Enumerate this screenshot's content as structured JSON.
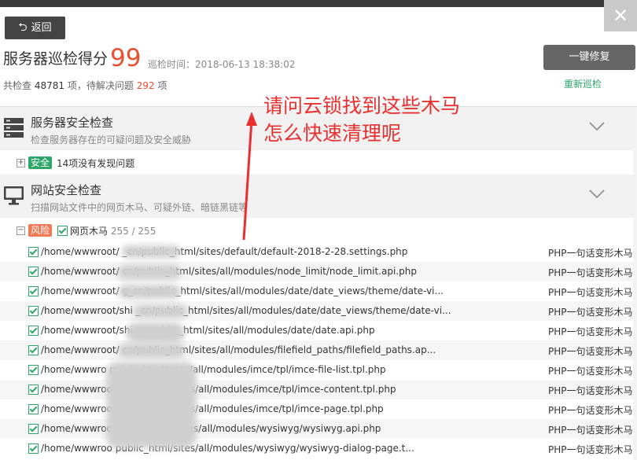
{
  "window": {
    "close_label": "✕"
  },
  "header": {
    "back_label": "返回",
    "score_title": "服务器巡检得分",
    "score": "99",
    "inspect_time": "巡检时间：2018-06-13 18:38:02",
    "summary_prefix": "共检查",
    "checked_count": "48781",
    "summary_mid": "项，待解决问题",
    "issue_count": "292",
    "summary_suffix": "项",
    "fix_button": "一键修复",
    "rescan_link": "重新巡检"
  },
  "annotation": {
    "line1": "请问云锁找到这些木马",
    "line2": "怎么快速清理呢"
  },
  "sections": [
    {
      "title": "服务器安全检查",
      "desc": "检查服务器存在的可疑问题及安全威胁",
      "sub": {
        "expander": "+",
        "tag": "安全",
        "label": "14项没有发现问题"
      }
    },
    {
      "title": "网站安全检查",
      "desc": "扫描网站文件中的网页木马、可疑外链、暗链黑链等",
      "sub": {
        "expander": "−",
        "tag": "风险",
        "label": "网页木马",
        "count": "255 / 255"
      }
    }
  ],
  "files": [
    {
      "path": "/home/wwwroot/                    _cn/public_html/sites/default/default-2018-2-28.settings.php",
      "type": "PHP一句话变形木马"
    },
    {
      "path": "/home/wwwroot/                    cn/public_html/sites/all/modules/node_limit/node_limit.api.php",
      "type": "PHP一句话变形木马"
    },
    {
      "path": "/home/wwwroot/                  g_cn/public_html/sites/all/modules/date/date_views/theme/date-vi...",
      "type": "PHP一句话变形木马"
    },
    {
      "path": "/home/wwwroot/shi            _cn/public_html/sites/all/modules/date/date_views/theme/date-vi...",
      "type": "PHP一句话变形木马"
    },
    {
      "path": "/home/wwwroot/shi                 cn/public_html/sites/all/modules/date/date.api.php",
      "type": "PHP一句话变形木马"
    },
    {
      "path": "/home/wwwroot/                    cn/public_html/sites/all/modules/filefield_paths/filefield_paths.ap...",
      "type": "PHP一句话变形木马"
    },
    {
      "path": "/home/wwwro                  public_html/sites/all/modules/imce/tpl/imce-file-list.tpl.php",
      "type": "PHP一句话变形木马"
    },
    {
      "path": "/home/wwwroo                  public_html/sites/all/modules/imce/tpl/imce-content.tpl.php",
      "type": "PHP一句话变形木马"
    },
    {
      "path": "/home/wwwroo                  public_html/sites/all/modules/imce/tpl/imce-page.tpl.php",
      "type": "PHP一句话变形木马"
    },
    {
      "path": "/home/wwwroo                  /public_html/sites/all/modules/wysiwyg/wysiwyg.api.php",
      "type": "PHP一句话变形木马"
    },
    {
      "path": "/home/wwwroo                  public_html/sites/all/modules/wysiwyg/wysiwyg-dialog-page.t...",
      "type": "PHP一句话变形木马"
    }
  ]
}
